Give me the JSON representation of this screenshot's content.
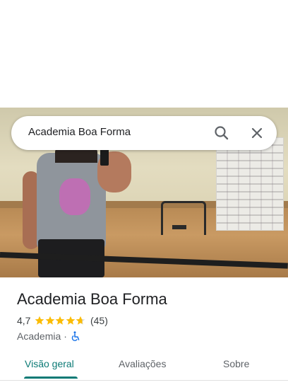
{
  "search": {
    "query": "Academia Boa Forma",
    "search_icon": "search-icon",
    "close_icon": "close-icon"
  },
  "place": {
    "name": "Academia Boa Forma",
    "rating": "4,7",
    "rating_value": 4.7,
    "stars_max": 5,
    "review_count": "(45)",
    "category": "Academia",
    "separator": "·",
    "accessibility_icon": "wheelchair-icon"
  },
  "tabs": [
    {
      "label": "Visão geral",
      "active": true
    },
    {
      "label": "Avaliações",
      "active": false
    },
    {
      "label": "Sobre",
      "active": false
    }
  ],
  "colors": {
    "accent": "#0b7a75",
    "star": "#fbbc04",
    "accessibility": "#1a73e8"
  }
}
